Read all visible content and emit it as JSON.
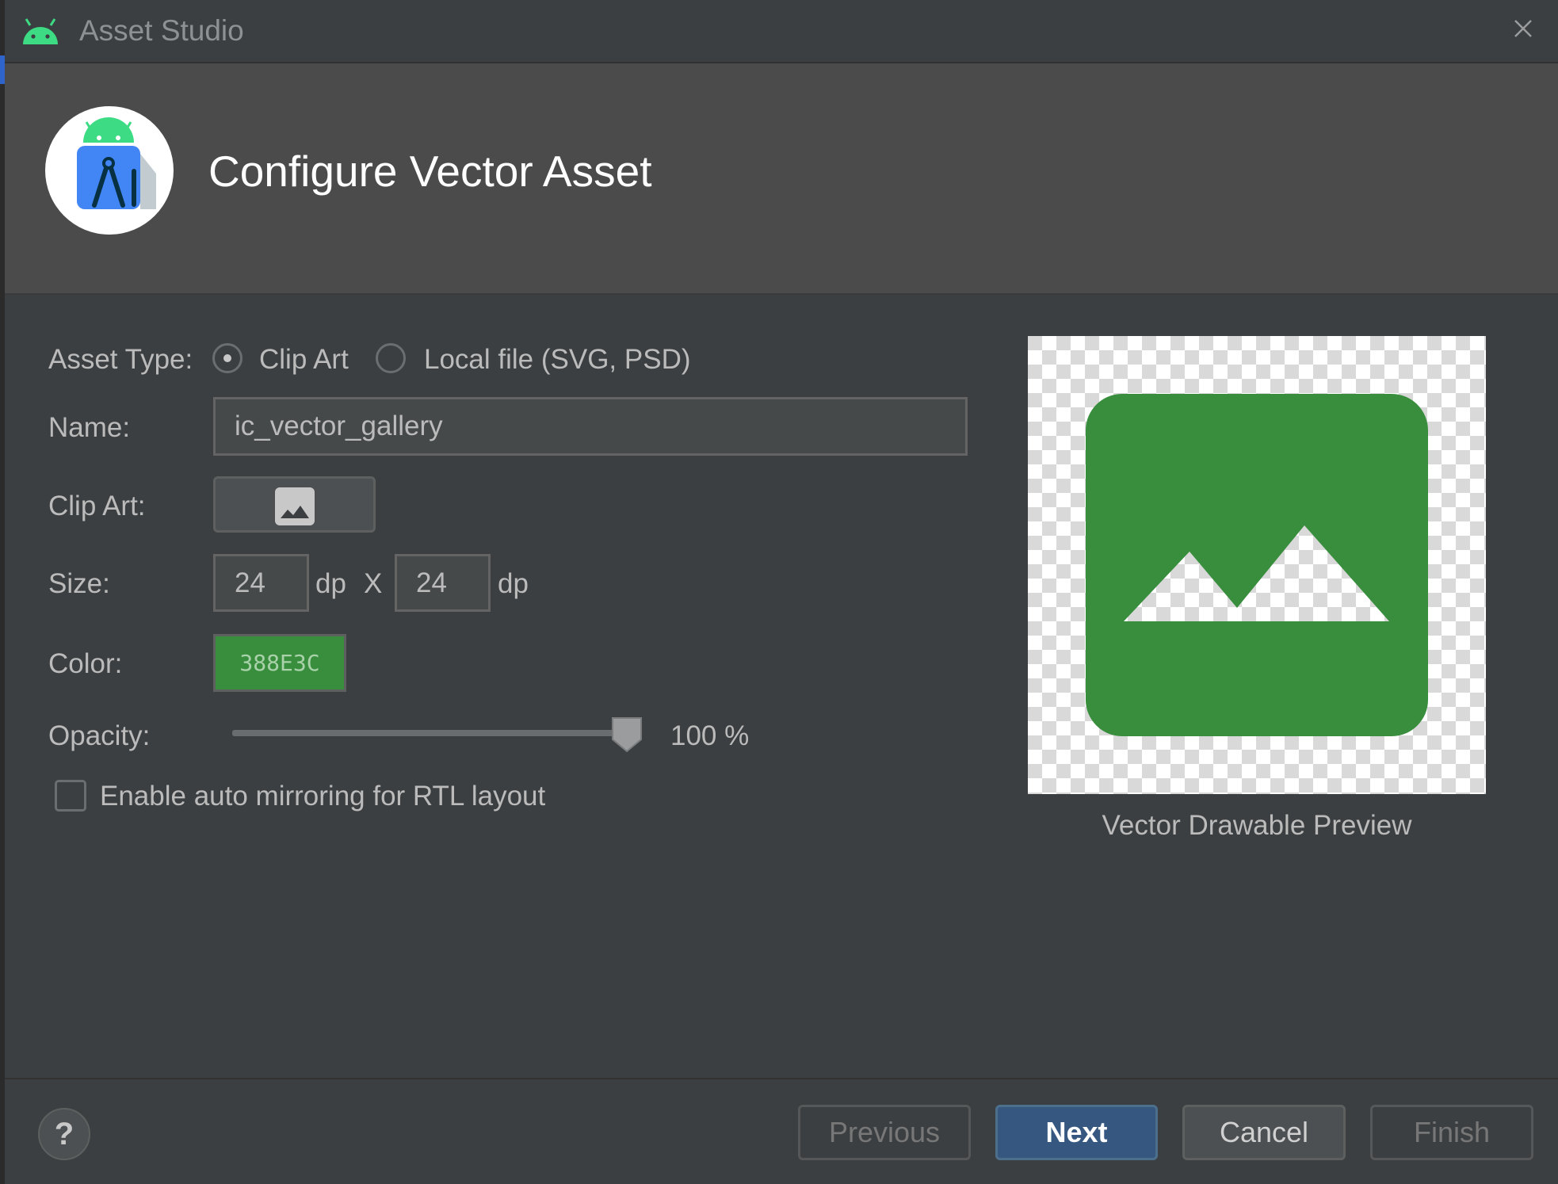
{
  "window": {
    "title": "Asset Studio"
  },
  "header": {
    "title": "Configure Vector Asset"
  },
  "form": {
    "asset_type_label": "Asset Type:",
    "asset_type_options": [
      {
        "label": "Clip Art",
        "selected": true
      },
      {
        "label": "Local file (SVG, PSD)",
        "selected": false
      }
    ],
    "name_label": "Name:",
    "name_value": "ic_vector_gallery",
    "clip_art_label": "Clip Art:",
    "clip_art_icon": "image-icon",
    "size_label": "Size:",
    "width_value": "24",
    "width_unit": "dp",
    "size_separator": "X",
    "height_value": "24",
    "height_unit": "dp",
    "color_label": "Color:",
    "color_value": "388E3C",
    "color_hex": "#388E3C",
    "opacity_label": "Opacity:",
    "opacity_percent": 100,
    "opacity_text": "100 %",
    "mirroring_label": "Enable auto mirroring for RTL layout",
    "mirroring_checked": false
  },
  "preview": {
    "caption": "Vector Drawable Preview",
    "icon": "image-icon",
    "icon_color": "#388E3C"
  },
  "footer": {
    "help_label": "?",
    "previous_label": "Previous",
    "next_label": "Next",
    "cancel_label": "Cancel",
    "finish_label": "Finish"
  }
}
